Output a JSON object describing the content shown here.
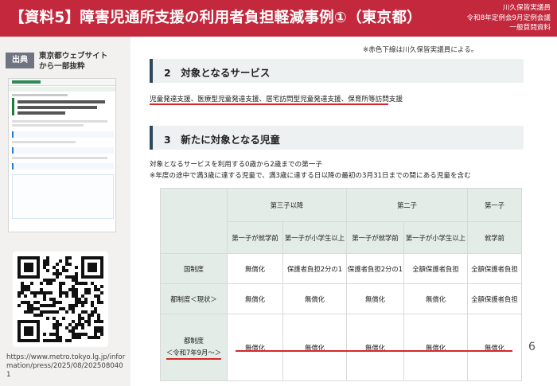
{
  "header": {
    "title": "【資料5】障害児通所支援の利用者負担軽減事例①（東京都）",
    "right_lines": [
      "川久保皆実議員",
      "令和8年定例会9月定例会議",
      "一般質問資料"
    ]
  },
  "source": {
    "badge": "出典",
    "text_lines": [
      "東京都ウェブサイト",
      "から一部抜粋"
    ],
    "url": "https://www.metro.tokyo.lg.jp/information/press/2025/08/2025080401"
  },
  "note": "※赤色下線は川久保皆実議員による。",
  "section2": {
    "heading": "2　対象となるサービス",
    "services": "児童発達支援、医療型児童発達支援、居宅訪問型児童発達支援、保育所等訪問支援"
  },
  "section3": {
    "heading": "3　新たに対象となる児童",
    "line1": "対象となるサービスを利用する0歳から2歳までの第一子",
    "line2": "※年度の途中で満3歳に達する児童で、満3歳に達する日以降の最初の3月31日までの間にある児童を含む"
  },
  "table": {
    "groups": [
      "第三子以降",
      "第二子",
      "第一子"
    ],
    "subheaders": [
      "第一子が就学前",
      "第一子が小学生以上",
      "第一子が就学前",
      "第一子が小学生以上",
      "就学前"
    ],
    "rows": [
      {
        "label": "国制度",
        "sub": "",
        "cells": [
          "無償化",
          "保護者負担2分の1",
          "保護者負担2分の1",
          "全額保護者負担",
          "全額保護者負担"
        ]
      },
      {
        "label": "都制度＜現状＞",
        "sub": "",
        "cells": [
          "無償化",
          "無償化",
          "無償化",
          "無償化",
          "全額保護者負担"
        ]
      },
      {
        "label": "都制度",
        "sub": "＜令和7年9月～＞",
        "cells": [
          "無償化",
          "無償化",
          "無償化",
          "無償化",
          "無償化"
        ]
      }
    ]
  },
  "page_number": "6"
}
